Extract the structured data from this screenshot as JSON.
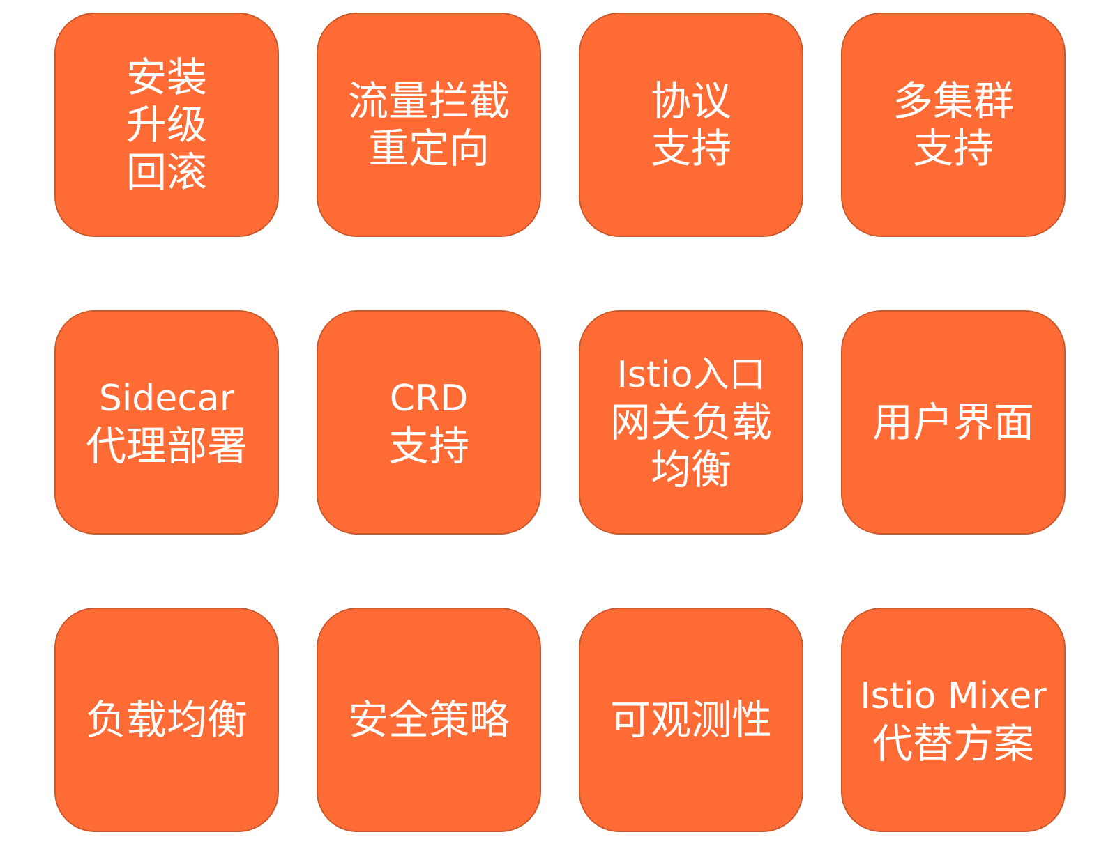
{
  "tile_color": "#ff6b35",
  "tiles": [
    {
      "lines": [
        "安装",
        "升级",
        "回滚"
      ]
    },
    {
      "lines": [
        "流量拦截",
        "重定向"
      ]
    },
    {
      "lines": [
        "协议",
        "支持"
      ]
    },
    {
      "lines": [
        "多集群",
        "支持"
      ]
    },
    {
      "lines": [
        "Sidecar",
        "代理部署"
      ]
    },
    {
      "lines": [
        "CRD",
        "支持"
      ]
    },
    {
      "lines": [
        "Istio入口",
        "网关负载",
        "均衡"
      ]
    },
    {
      "lines": [
        "用户界面"
      ]
    },
    {
      "lines": [
        "负载均衡"
      ]
    },
    {
      "lines": [
        "安全策略"
      ]
    },
    {
      "lines": [
        "可观测性"
      ]
    },
    {
      "lines": [
        "Istio Mixer",
        "代替方案"
      ]
    }
  ]
}
